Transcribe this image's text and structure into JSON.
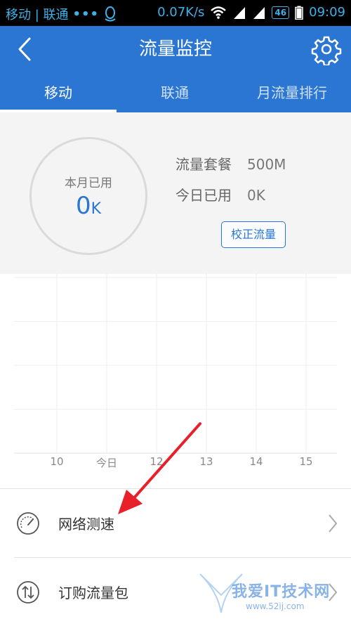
{
  "status_bar": {
    "carrier": "移动 | 联通",
    "dots": "•••",
    "speed": "0.07K/s",
    "network_badge": "46",
    "time": "09:09"
  },
  "titlebar": {
    "title": "流量监控",
    "back_icon": "chevron-left-icon",
    "settings_icon": "gear-icon"
  },
  "tabs": [
    {
      "label": "移动",
      "active": true
    },
    {
      "label": "联通",
      "active": false
    },
    {
      "label": "月流量排行",
      "active": false
    }
  ],
  "summary": {
    "ring_label": "本月已用",
    "ring_value": "0",
    "ring_unit": "K",
    "plan_label": "流量套餐",
    "plan_value": "500M",
    "today_label": "今日已用",
    "today_value": "0K",
    "calibrate_button": "校正流量"
  },
  "chart_data": {
    "type": "line",
    "x": [
      "10",
      "今日",
      "12",
      "13",
      "14",
      "15"
    ],
    "series": [],
    "grid": true
  },
  "list": [
    {
      "label": "网络测速",
      "icon": "speedometer-icon"
    },
    {
      "label": "订购流量包",
      "icon": "transfer-arrows-icon"
    }
  ],
  "watermark": {
    "text": "我爱IT技术网",
    "url": "www.52ij.com"
  },
  "colors": {
    "primary": "#2a76d2",
    "status_text": "#3fb0e8",
    "arrow": "#e8202a",
    "summary_bg": "#f4f4f4"
  }
}
